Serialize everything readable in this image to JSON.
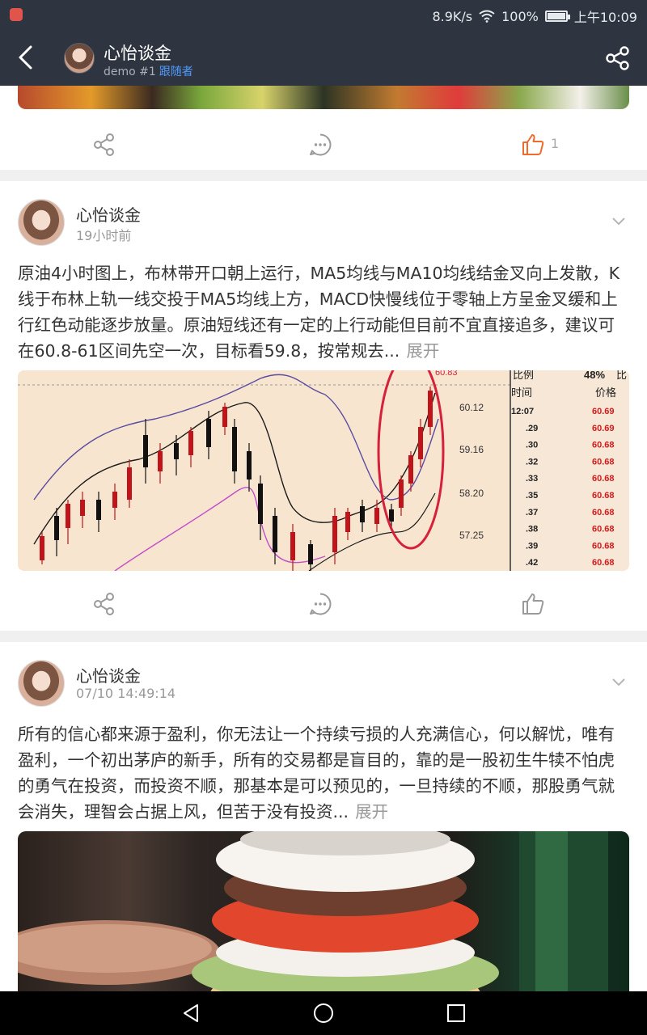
{
  "status_bar": {
    "speed": "8.9K/s",
    "battery": "100%",
    "time": "上午10:09"
  },
  "header": {
    "title": "心怡谈金",
    "demo": "demo #1",
    "follow_label": "跟随者"
  },
  "posts": [
    {
      "like_count": "1"
    },
    {
      "author": "心怡谈金",
      "time": "19小时前",
      "text": "原油4小时图上，布林带开口朝上运行，MA5均线与MA10均线结金叉向上发散，K线于布林上轨一线交投于MA5均线上方，MACD快慢线位于零轴上方呈金叉缓和上行红色动能逐步放量。原油短线还有一定的上行动能但目前不宜直接追多，建议可在60.8-61区间先空一次，目标看59.8，按常规去...",
      "expand_label": "展开",
      "chart": {
        "header_left": "比例",
        "header_pct": "48%",
        "header_right": "比",
        "col_time": "时间",
        "col_price": "价格",
        "top_value": "60.83",
        "y_labels": [
          "60.12",
          "59.16",
          "58.20",
          "57.25"
        ],
        "rows": [
          {
            "t": "12:07",
            "p": "60.69"
          },
          {
            "t": ".29",
            "p": "60.69"
          },
          {
            "t": ".30",
            "p": "60.68"
          },
          {
            "t": ".32",
            "p": "60.68"
          },
          {
            "t": ".33",
            "p": "60.68"
          },
          {
            "t": ".35",
            "p": "60.68"
          },
          {
            "t": ".37",
            "p": "60.68"
          },
          {
            "t": ".38",
            "p": "60.68"
          },
          {
            "t": ".39",
            "p": "60.68"
          },
          {
            "t": ".42",
            "p": "60.68"
          }
        ]
      }
    },
    {
      "author": "心怡谈金",
      "time": "07/10 14:49:14",
      "text": "所有的信心都来源于盈利，你无法让一个持续亏损的人充满信心，何以解忧，唯有盈利，一个初出茅庐的新手，所有的交易都是盲目的，靠的是一股初生牛犊不怕虎的勇气在投资，而投资不顺，那基本是可以预见的，一旦持续的不顺，那股勇气就会消失，理智会占据上风，但苦于没有投资...",
      "expand_label": "展开"
    }
  ],
  "colors": {
    "accent": "#f06a2d",
    "link": "#4f9bff",
    "header_bg": "#2f3540"
  }
}
